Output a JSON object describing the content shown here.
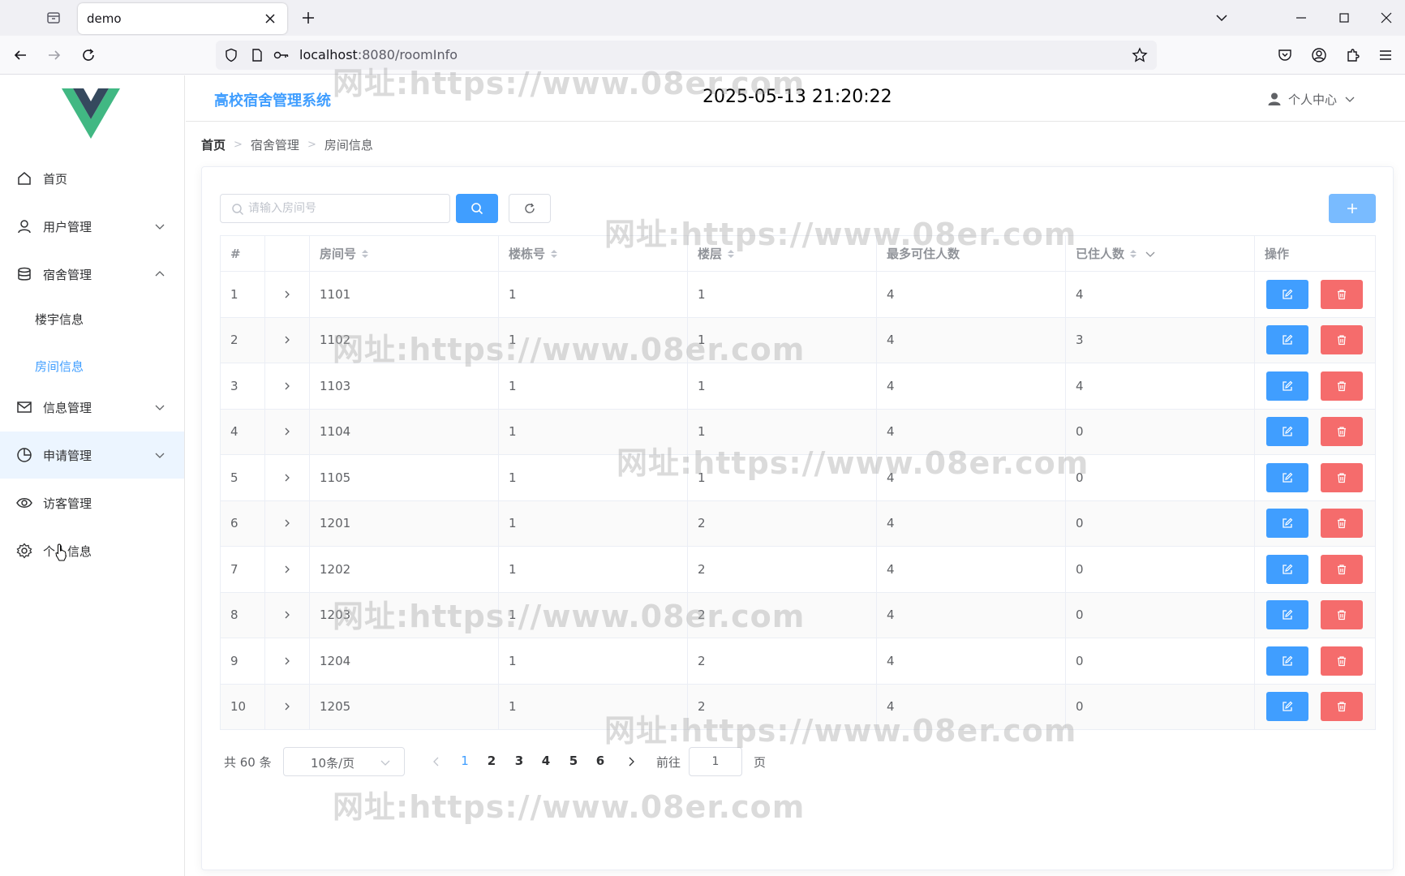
{
  "browser": {
    "tab_title": "demo",
    "url_host": "localhost",
    "url_rest": ":8080/roomInfo"
  },
  "sidebar": {
    "items": [
      {
        "label": "首页",
        "icon": "home-icon"
      },
      {
        "label": "用户管理",
        "icon": "user-icon"
      },
      {
        "label": "宿舍管理",
        "icon": "database-icon"
      },
      {
        "label": "信息管理",
        "icon": "message-icon"
      },
      {
        "label": "申请管理",
        "icon": "pie-chart-icon"
      },
      {
        "label": "访客管理",
        "icon": "view-icon"
      },
      {
        "label": "个人信息",
        "icon": "setting-icon"
      }
    ],
    "sub_items": [
      {
        "label": "楼宇信息"
      },
      {
        "label": "房间信息"
      }
    ]
  },
  "header": {
    "title": "高校宿舍管理系统",
    "clock": "2025-05-13 21:20:22",
    "user_center": "个人中心"
  },
  "breadcrumb": {
    "home": "首页",
    "level1": "宿舍管理",
    "level2": "房间信息"
  },
  "toolbar": {
    "search_placeholder": "请输入房间号"
  },
  "table": {
    "columns": [
      "#",
      "",
      "房间号",
      "楼栋号",
      "楼层",
      "最多可住人数",
      "已住人数",
      "操作"
    ],
    "rows": [
      {
        "index": "1",
        "room": "1101",
        "building": "1",
        "floor": "1",
        "max": "4",
        "current": "4"
      },
      {
        "index": "2",
        "room": "1102",
        "building": "1",
        "floor": "1",
        "max": "4",
        "current": "3"
      },
      {
        "index": "3",
        "room": "1103",
        "building": "1",
        "floor": "1",
        "max": "4",
        "current": "4"
      },
      {
        "index": "4",
        "room": "1104",
        "building": "1",
        "floor": "1",
        "max": "4",
        "current": "0"
      },
      {
        "index": "5",
        "room": "1105",
        "building": "1",
        "floor": "1",
        "max": "4",
        "current": "0"
      },
      {
        "index": "6",
        "room": "1201",
        "building": "1",
        "floor": "2",
        "max": "4",
        "current": "0"
      },
      {
        "index": "7",
        "room": "1202",
        "building": "1",
        "floor": "2",
        "max": "4",
        "current": "0"
      },
      {
        "index": "8",
        "room": "1203",
        "building": "1",
        "floor": "2",
        "max": "4",
        "current": "0"
      },
      {
        "index": "9",
        "room": "1204",
        "building": "1",
        "floor": "2",
        "max": "4",
        "current": "0"
      },
      {
        "index": "10",
        "room": "1205",
        "building": "1",
        "floor": "2",
        "max": "4",
        "current": "0"
      }
    ]
  },
  "pagination": {
    "total": "共 60 条",
    "page_size": "10条/页",
    "pages": [
      "1",
      "2",
      "3",
      "4",
      "5",
      "6"
    ],
    "current_page": "1",
    "goto_label": "前往",
    "jump_value": "1",
    "page_suffix": "页"
  },
  "watermark": "网址:https://www.08er.com",
  "colors": {
    "primary": "#409eff",
    "danger": "#f56c6c",
    "logo_green": "#41b883",
    "logo_dark": "#35495e"
  }
}
